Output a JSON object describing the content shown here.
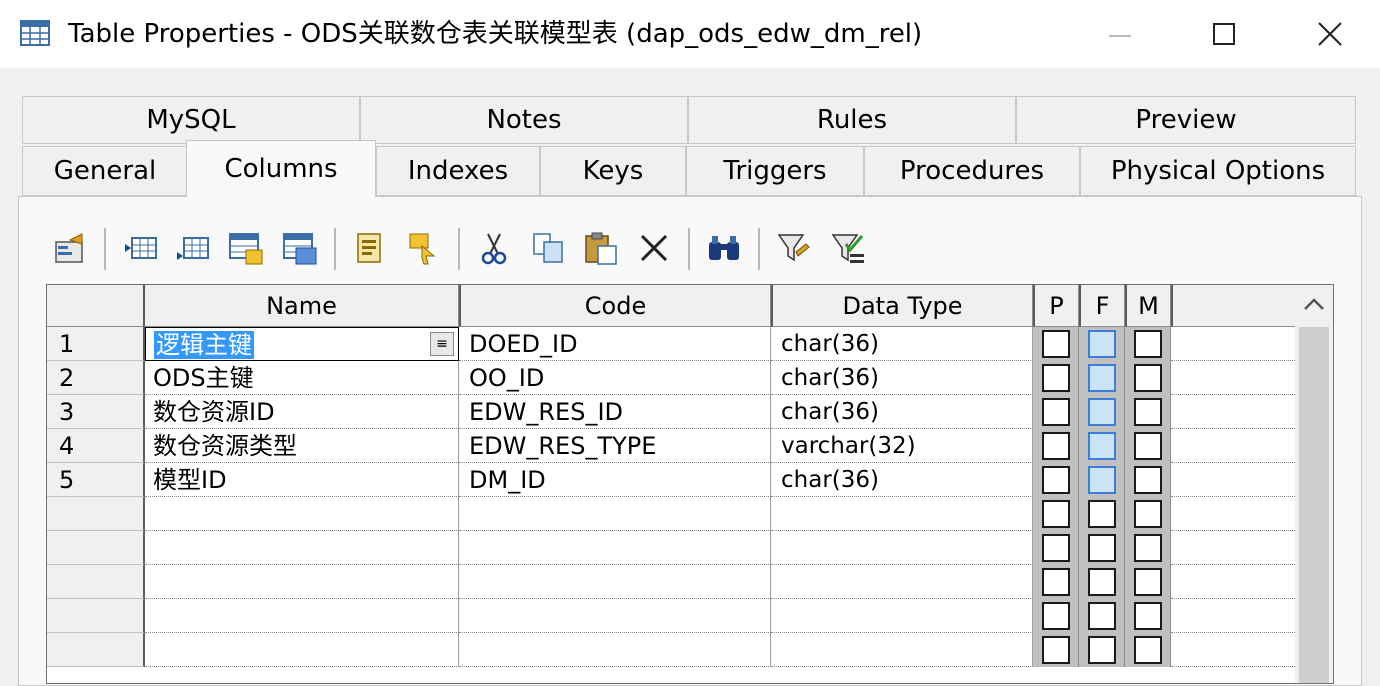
{
  "window": {
    "title": "Table Properties - ODS关联数仓表关联模型表 (dap_ods_edw_dm_rel)"
  },
  "tabs_top": [
    {
      "label": "MySQL"
    },
    {
      "label": "Notes"
    },
    {
      "label": "Rules"
    },
    {
      "label": "Preview"
    }
  ],
  "tabs_bottom": [
    {
      "label": "General"
    },
    {
      "label": "Columns",
      "active": true
    },
    {
      "label": "Indexes"
    },
    {
      "label": "Keys"
    },
    {
      "label": "Triggers"
    },
    {
      "label": "Procedures"
    },
    {
      "label": "Physical Options"
    }
  ],
  "toolbar": [
    "properties-icon",
    "insert-row-icon",
    "add-row-icon",
    "add-columns-icon",
    "reuse-columns-icon",
    "copy-columns-icon",
    "replicate-columns-icon",
    "cut-icon",
    "copy-icon",
    "paste-icon",
    "delete-icon",
    "find-icon",
    "filter-icon",
    "filter-apply-icon"
  ],
  "grid": {
    "headers": {
      "name": "Name",
      "code": "Code",
      "data_type": "Data Type",
      "p": "P",
      "f": "F",
      "m": "M"
    },
    "rows": [
      {
        "num": "1",
        "name": "逻辑主键",
        "code": "DOED_ID",
        "data_type": "char(36)",
        "p": false,
        "f": true,
        "m": false,
        "editing": true
      },
      {
        "num": "2",
        "name": "ODS主键",
        "code": "OO_ID",
        "data_type": "char(36)",
        "p": false,
        "f": true,
        "m": false
      },
      {
        "num": "3",
        "name": "数仓资源ID",
        "code": "EDW_RES_ID",
        "data_type": "char(36)",
        "p": false,
        "f": true,
        "m": false
      },
      {
        "num": "4",
        "name": "数仓资源类型",
        "code": "EDW_RES_TYPE",
        "data_type": "varchar(32)",
        "p": false,
        "f": true,
        "m": false
      },
      {
        "num": "5",
        "name": "模型ID",
        "code": "DM_ID",
        "data_type": "char(36)",
        "p": false,
        "f": true,
        "m": false
      },
      {
        "num": "",
        "name": "",
        "code": "",
        "data_type": "",
        "p": false,
        "f": false,
        "m": false
      },
      {
        "num": "",
        "name": "",
        "code": "",
        "data_type": "",
        "p": false,
        "f": false,
        "m": false
      },
      {
        "num": "",
        "name": "",
        "code": "",
        "data_type": "",
        "p": false,
        "f": false,
        "m": false
      },
      {
        "num": "",
        "name": "",
        "code": "",
        "data_type": "",
        "p": false,
        "f": false,
        "m": false
      },
      {
        "num": "",
        "name": "",
        "code": "",
        "data_type": "",
        "p": false,
        "f": false,
        "m": false
      }
    ]
  },
  "colors": {
    "selection": "#3399ff",
    "checkbox_f": "#cce4f7"
  }
}
